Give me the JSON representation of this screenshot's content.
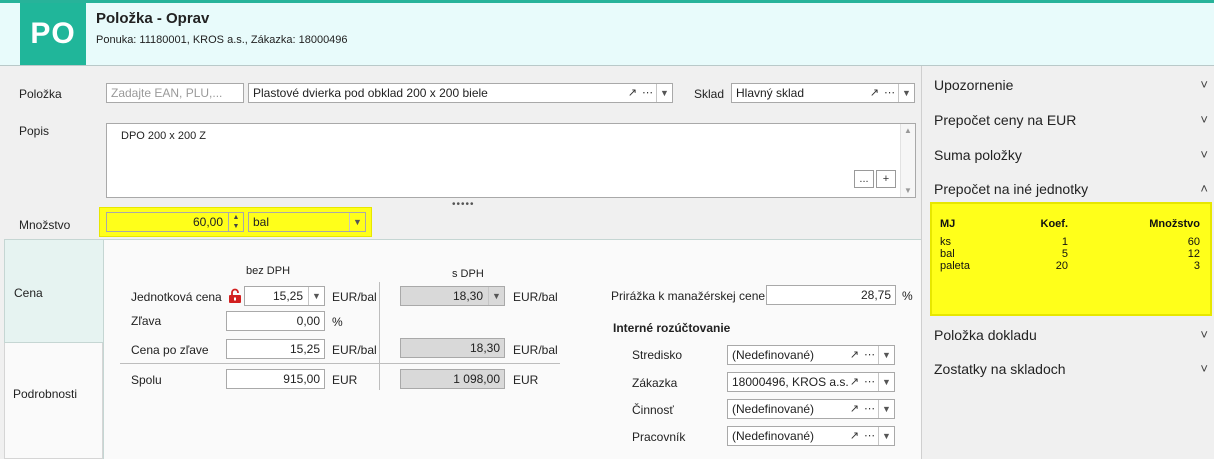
{
  "header": {
    "badge": "PO",
    "title": "Položka - Oprav",
    "subtitle": "Ponuka: 11180001, KROS a.s., Zákazka: 18000496"
  },
  "form": {
    "polozka_label": "Položka",
    "ean_placeholder": "Zadajte EAN, PLU,...",
    "product_value": "Plastové dvierka pod obklad 200 x 200 biele",
    "sklad_label": "Sklad",
    "sklad_value": "Hlavný sklad",
    "popis_label": "Popis",
    "popis_value": "DPO 200 x 200 Z",
    "popis_more_btn": "...",
    "popis_add_btn": "+",
    "mnozstvo_label": "Množstvo",
    "mnozstvo_value": "60,00",
    "unit_value": "bal"
  },
  "tabs": [
    {
      "label": "Cena"
    },
    {
      "label": "Podrobnosti"
    }
  ],
  "cena": {
    "bez_dph_header": "bez DPH",
    "s_dph_header": "s DPH",
    "jednotkova_label": "Jednotková cena",
    "jednotkova_value": "15,25",
    "jednotkova_unit": "EUR/bal",
    "jednotkova_s_dph": "18,30",
    "jednotkova_s_dph_unit": "EUR/bal",
    "zlava_label": "Zľava",
    "zlava_value": "0,00",
    "zlava_unit": "%",
    "po_zlave_label": "Cena po zľave",
    "po_zlave_value": "15,25",
    "po_zlave_unit": "EUR/bal",
    "po_zlave_s_dph": "18,30",
    "po_zlave_s_dph_unit": "EUR/bal",
    "spolu_label": "Spolu",
    "spolu_value": "915,00",
    "spolu_unit": "EUR",
    "spolu_s_dph": "1 098,00",
    "spolu_s_dph_unit": "EUR",
    "prirazka_label": "Prirážka k manažérskej cene",
    "prirazka_value": "28,75",
    "prirazka_unit": "%"
  },
  "rozuctovanie": {
    "title": "Interné rozúčtovanie",
    "rows": [
      {
        "label": "Stredisko",
        "value": "(Nedefinované)"
      },
      {
        "label": "Zákazka",
        "value": "18000496, KROS a.s."
      },
      {
        "label": "Činnosť",
        "value": "(Nedefinované)"
      },
      {
        "label": "Pracovník",
        "value": "(Nedefinované)"
      }
    ]
  },
  "right_panel": {
    "items": [
      {
        "label": "Upozornenie",
        "chevron": "˅"
      },
      {
        "label": "Prepočet ceny na EUR",
        "chevron": "˅"
      },
      {
        "label": "Suma položky",
        "chevron": "˅"
      },
      {
        "label": "Prepočet na iné jednotky",
        "chevron": "˄"
      },
      {
        "label": "Položka dokladu",
        "chevron": "˅"
      },
      {
        "label": "Zostatky na skladoch",
        "chevron": "˅"
      }
    ],
    "units_table": {
      "headers": [
        "MJ",
        "Koef.",
        "Množstvo"
      ],
      "rows": [
        [
          "ks",
          "1",
          "60"
        ],
        [
          "bal",
          "5",
          "12"
        ],
        [
          "paleta",
          "20",
          "3"
        ]
      ]
    }
  },
  "colors": {
    "accent": "#20b69a",
    "highlight": "#ffff1a",
    "header_bg": "#e8fbfb"
  }
}
